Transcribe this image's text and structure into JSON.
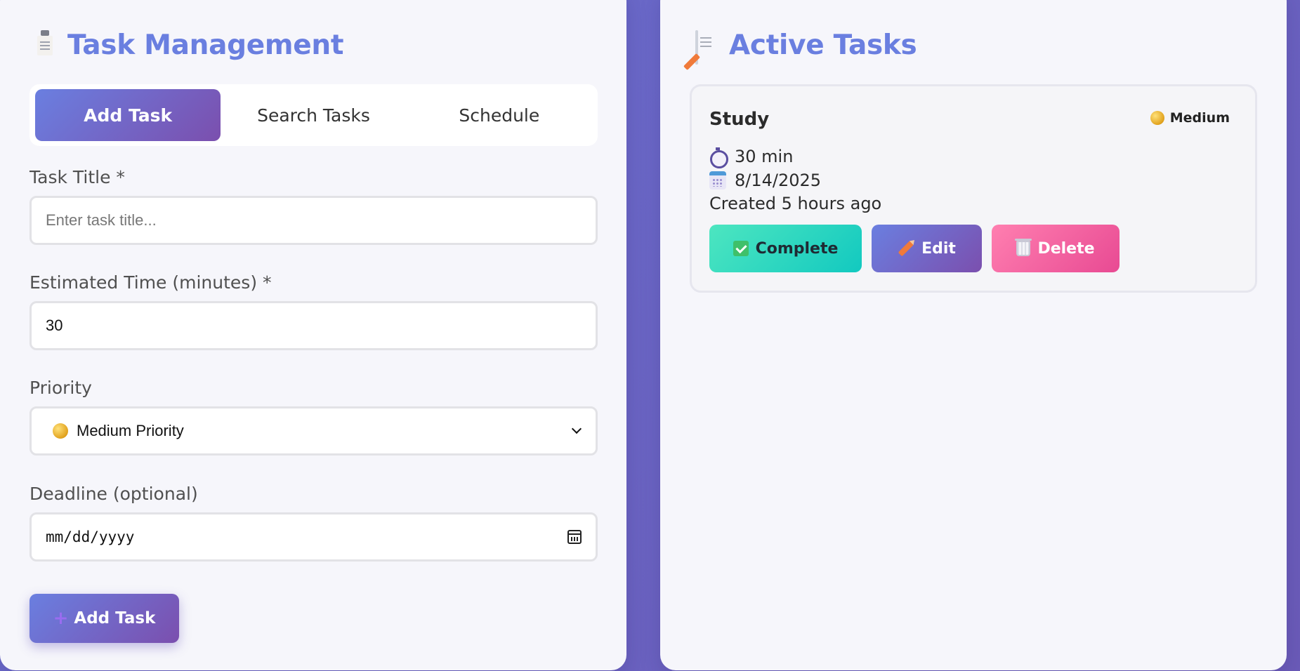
{
  "left_panel": {
    "title": "Task Management",
    "title_icon": "clipboard-icon",
    "tabs": [
      {
        "label": "Add Task",
        "active": true
      },
      {
        "label": "Search Tasks",
        "active": false
      },
      {
        "label": "Schedule",
        "active": false
      }
    ],
    "form": {
      "title_label": "Task Title *",
      "title_placeholder": "Enter task title...",
      "time_label": "Estimated Time (minutes) *",
      "time_value": "30",
      "priority_label": "Priority",
      "priority_value": "Medium Priority",
      "priority_icon": "yellow-circle-icon",
      "deadline_label": "Deadline (optional)",
      "deadline_placeholder": "mm/dd/yyyy",
      "submit_label": "Add Task",
      "submit_icon": "plus-icon"
    }
  },
  "right_panel": {
    "title": "Active Tasks",
    "title_icon": "memo-icon",
    "tasks": [
      {
        "title": "Study",
        "priority": "Medium",
        "duration": "30 min",
        "deadline": "8/14/2025",
        "created": "Created 5 hours ago",
        "actions": {
          "complete": "Complete",
          "edit": "Edit",
          "delete": "Delete"
        }
      }
    ]
  },
  "colors": {
    "accent": "#6a7fe0",
    "accent_dark": "#7b4fae",
    "background": "#6b5bb8",
    "complete": "#12c9c0",
    "delete": "#e84a93"
  }
}
